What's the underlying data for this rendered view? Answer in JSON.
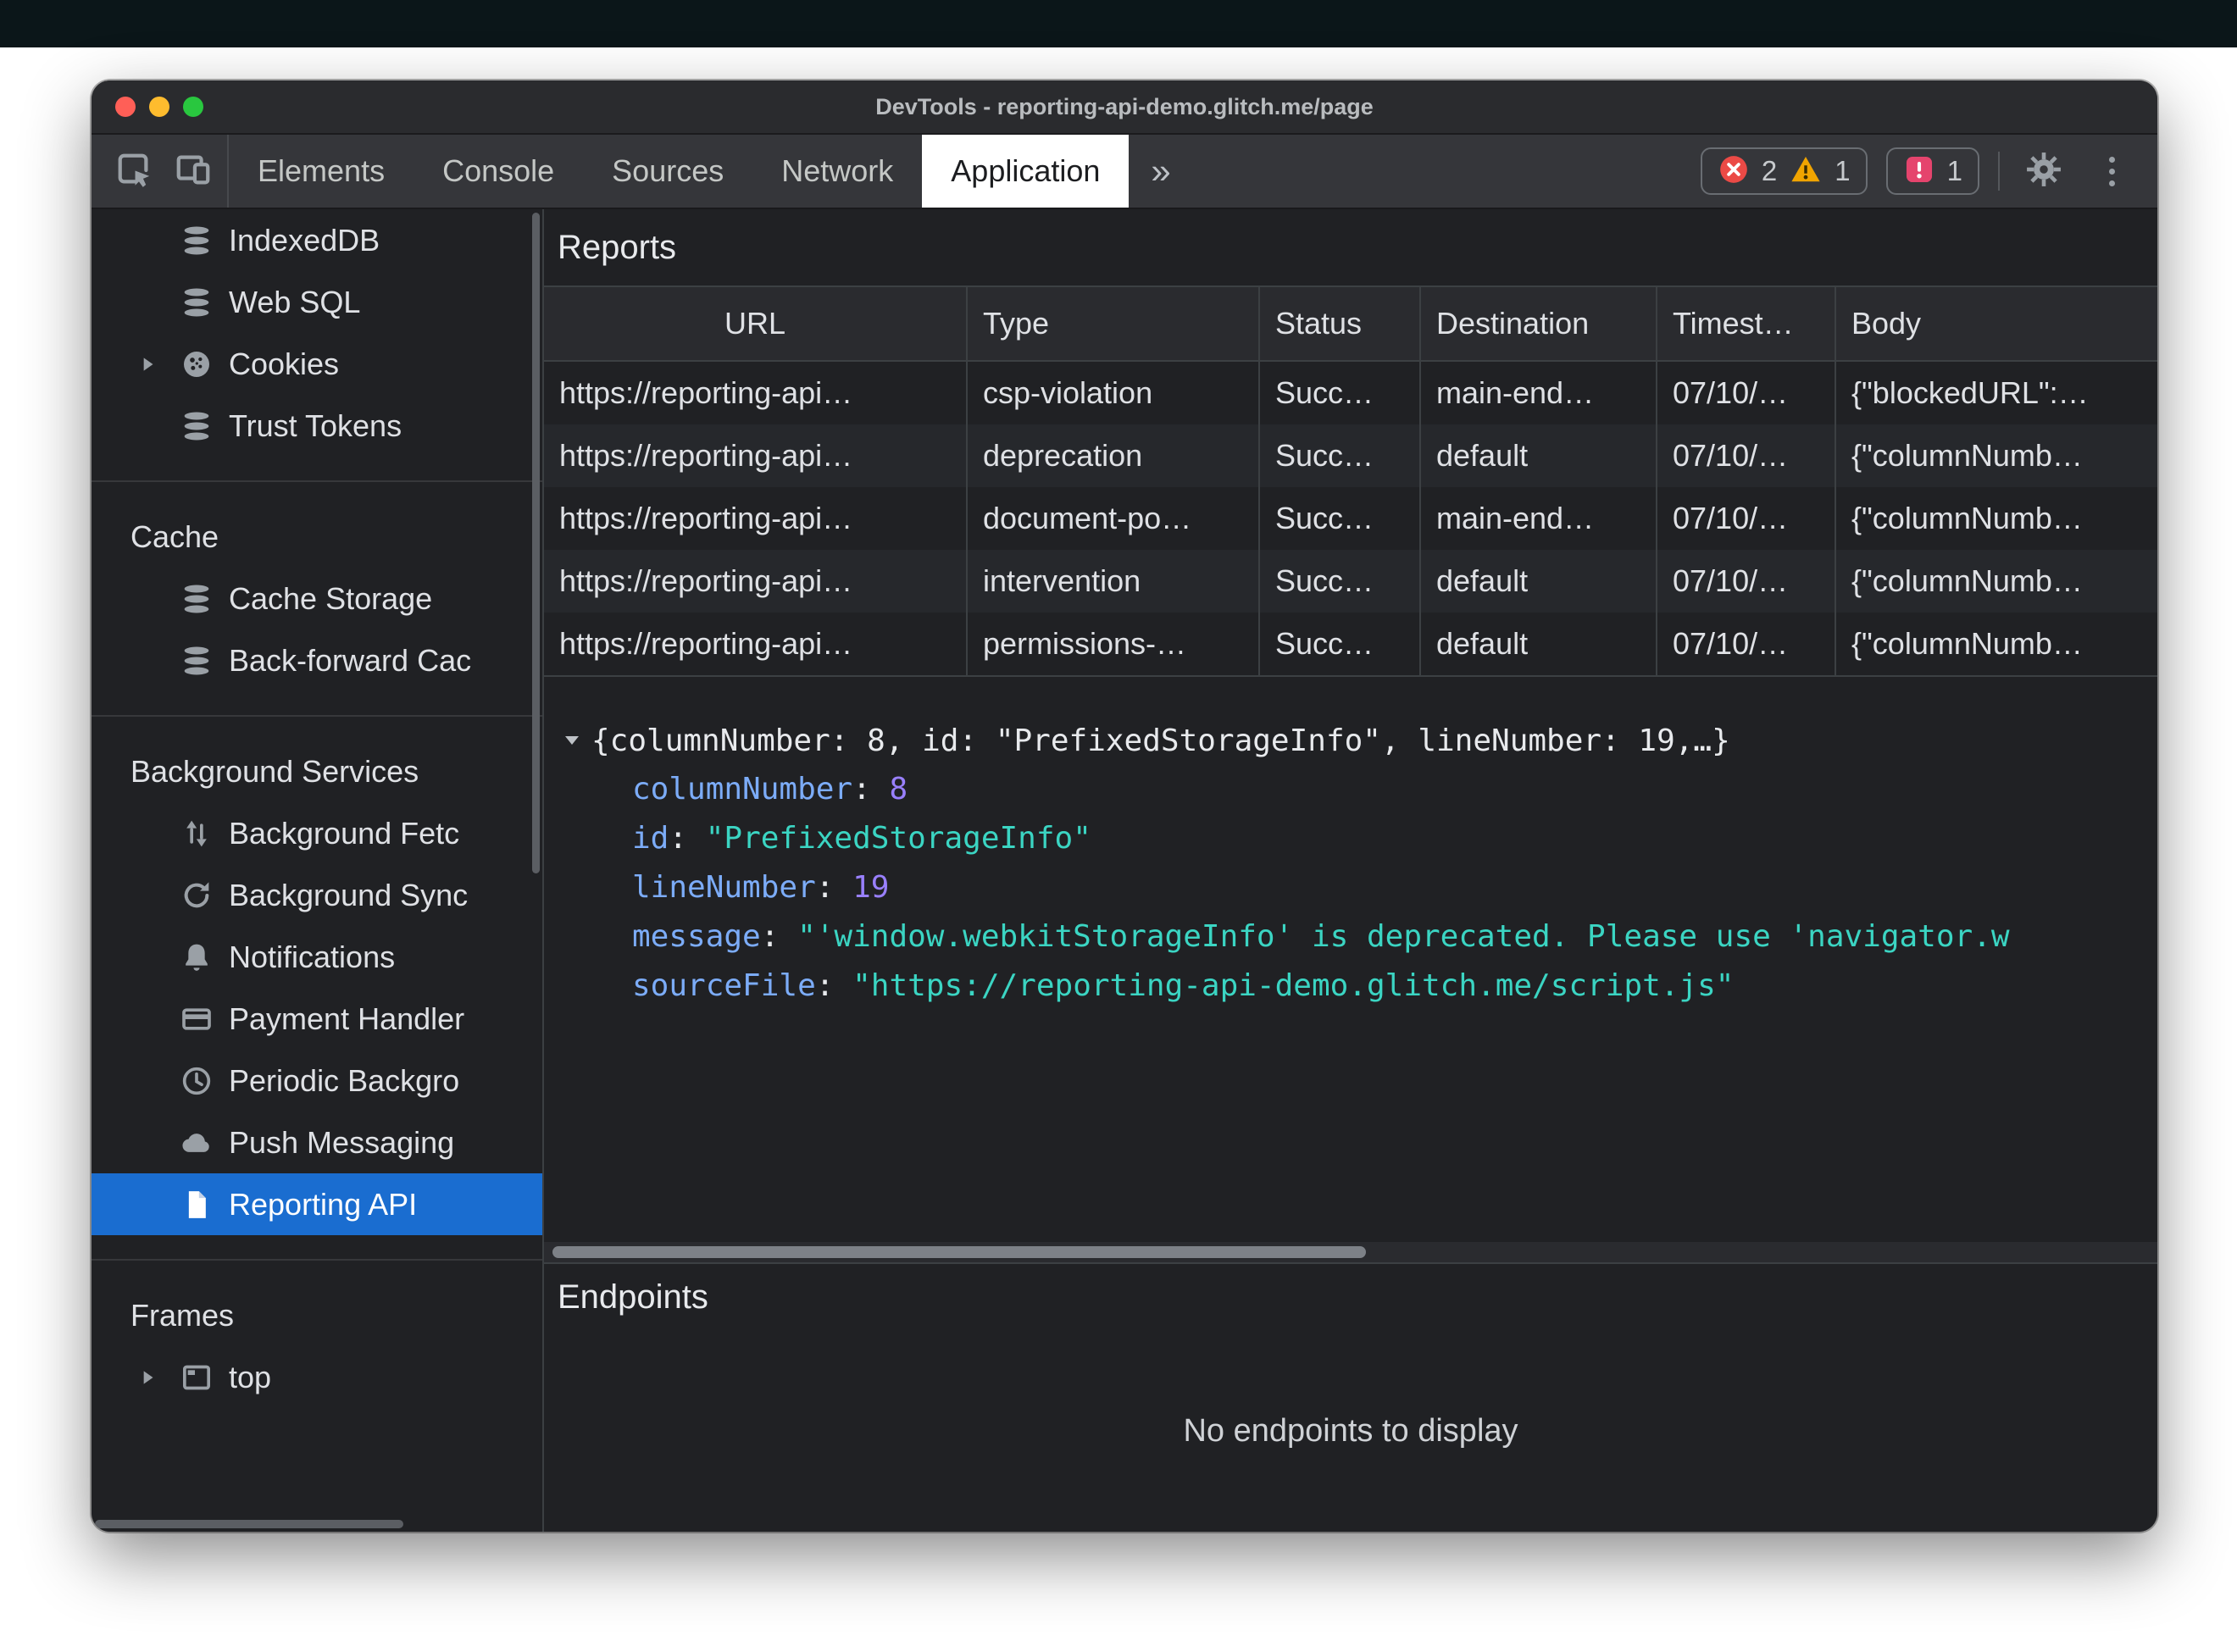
{
  "window": {
    "title": "DevTools - reporting-api-demo.glitch.me/page"
  },
  "toolbar": {
    "tabs": [
      "Elements",
      "Console",
      "Sources",
      "Network",
      "Application"
    ],
    "active_tab": "Application",
    "more_symbol": "»",
    "badges": {
      "errors": "2",
      "warnings": "1",
      "issues": "1"
    }
  },
  "sidebar": {
    "storage_items": [
      {
        "label": "IndexedDB"
      },
      {
        "label": "Web SQL"
      },
      {
        "label": "Cookies"
      },
      {
        "label": "Trust Tokens"
      }
    ],
    "cache_header": "Cache",
    "cache_items": [
      {
        "label": "Cache Storage"
      },
      {
        "label": "Back-forward Cac"
      }
    ],
    "bg_header": "Background Services",
    "bg_items": [
      {
        "label": "Background Fetc"
      },
      {
        "label": "Background Sync"
      },
      {
        "label": "Notifications"
      },
      {
        "label": "Payment Handler"
      },
      {
        "label": "Periodic Backgro"
      },
      {
        "label": "Push Messaging"
      },
      {
        "label": "Reporting API"
      }
    ],
    "frames_header": "Frames",
    "frames_items": [
      {
        "label": "top"
      }
    ]
  },
  "reports": {
    "title": "Reports",
    "columns": [
      "URL",
      "Type",
      "Status",
      "Destination",
      "Timest…",
      "Body"
    ],
    "rows": [
      [
        "https://reporting-api…",
        "csp-violation",
        "Succ…",
        "main-end…",
        "07/10/…",
        "{\"blockedURL\":…"
      ],
      [
        "https://reporting-api…",
        "deprecation",
        "Succ…",
        "default",
        "07/10/…",
        "{\"columnNumb…"
      ],
      [
        "https://reporting-api…",
        "document-po…",
        "Succ…",
        "main-end…",
        "07/10/…",
        "{\"columnNumb…"
      ],
      [
        "https://reporting-api…",
        "intervention",
        "Succ…",
        "default",
        "07/10/…",
        "{\"columnNumb…"
      ],
      [
        "https://reporting-api…",
        "permissions-…",
        "Succ…",
        "default",
        "07/10/…",
        "{\"columnNumb…"
      ]
    ],
    "detail": {
      "preview": "{columnNumber: 8, id: \"PrefixedStorageInfo\", lineNumber: 19,…}",
      "props": [
        {
          "key": "columnNumber",
          "value": "8"
        },
        {
          "key": "id",
          "value": "\"PrefixedStorageInfo\""
        },
        {
          "key": "lineNumber",
          "value": "19"
        },
        {
          "key": "message",
          "value": "\"'window.webkitStorageInfo' is deprecated. Please use 'navigator.w"
        },
        {
          "key": "sourceFile",
          "value": "\"https://reporting-api-demo.glitch.me/script.js\""
        }
      ]
    }
  },
  "endpoints": {
    "title": "Endpoints",
    "empty": "No endpoints to display"
  },
  "colors": {
    "selection_blue": "#1a6dd0",
    "error_red": "#eb4a46",
    "warning_yellow": "#f0a400",
    "issues_pink": "#e5446d",
    "key_blue": "#7cacf8",
    "number_violet": "#9980ff",
    "string_teal": "#3bd5c3"
  }
}
